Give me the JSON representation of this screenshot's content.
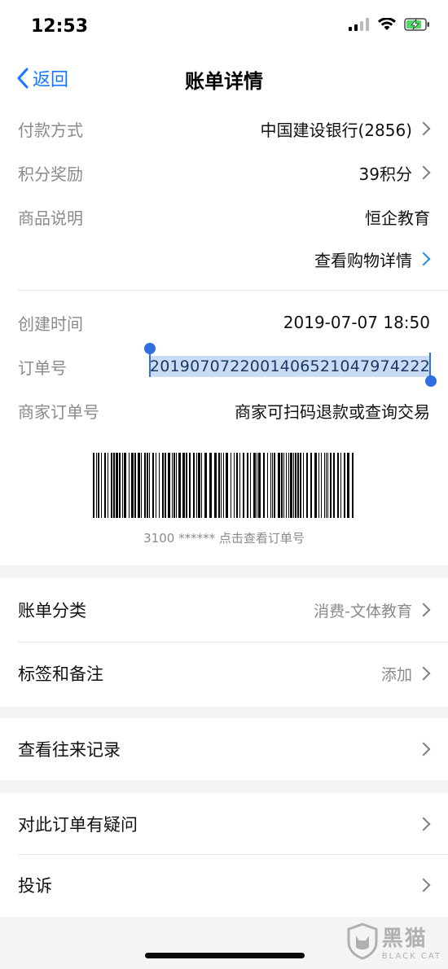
{
  "status_bar": {
    "time": "12:53"
  },
  "nav": {
    "back_label": "返回",
    "title": "账单详情"
  },
  "details": [
    {
      "label": "付款方式",
      "value": "中国建设银行(2856)"
    },
    {
      "label": "积分奖励",
      "value": "39积分"
    },
    {
      "label": "商品说明",
      "value": "恒企教育"
    }
  ],
  "shopping_link": "查看购物详情",
  "order_info": {
    "created_label": "创建时间",
    "created_value": "2019-07-07 18:50",
    "order_no_label": "订单号",
    "order_no_value": "20190707220014065210479742​22",
    "merchant_label": "商家订单号",
    "merchant_value": "商家可扫码退款或查询交易"
  },
  "barcode_caption": "3100 ****** 点击查看订单号",
  "category": {
    "label": "账单分类",
    "value": "消费-文体教育"
  },
  "tags": {
    "label": "标签和备注",
    "value": "添加"
  },
  "history": {
    "label": "查看往来记录"
  },
  "question": {
    "label": "对此订单有疑问"
  },
  "complaint": {
    "label": "投诉"
  },
  "watermark": {
    "cn": "黑猫",
    "en": "BLACK CAT"
  }
}
